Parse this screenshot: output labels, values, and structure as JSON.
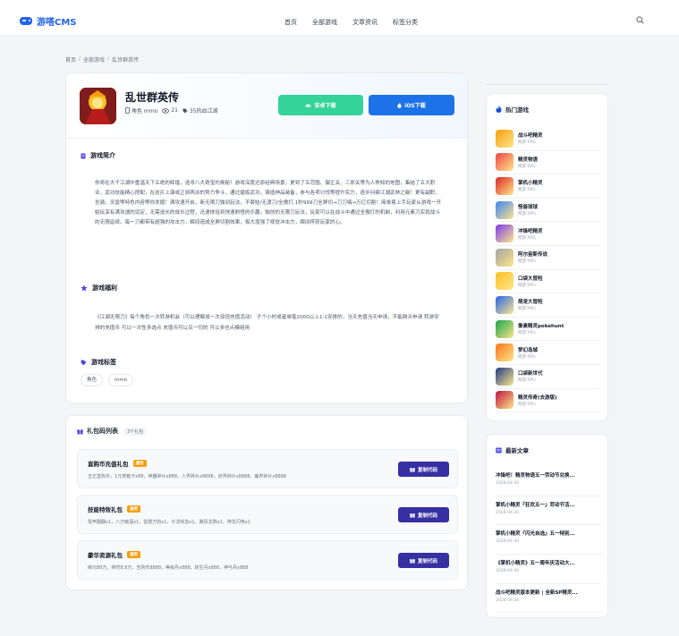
{
  "header": {
    "logo_text": "游嗒CMS",
    "nav": [
      "首页",
      "全部游戏",
      "文章资讯",
      "标签分类"
    ]
  },
  "breadcrumb": [
    "首页",
    "全部游戏",
    "乱世群英传"
  ],
  "game": {
    "title": "乱世群英传",
    "category": "角色 mmo",
    "views": "21",
    "tag_label": "35热血江湖",
    "android_label": "安卓下载",
    "ios_label": "iOS下载"
  },
  "intro": {
    "title": "游戏简介",
    "text": "你将在大千江湖中重温天下五绝的辉煌，追寻八大奇宝的奥秘！游戏深度还原经典场景，更到了五范围、御正关、三邪关等为人熟知的地图，集结了五大职业，武功技能精心搭配，在这片上演或正邪两派的势力争斗，通过磨练武功，铸造神品装备，参与各项讨伐等提升实力，逐步问鼎江湖武林之巅！更有副职、坐骑、灵兽等特色内容等你发掘！满攻速开启，新无限刀独到玩法，不套娃/无渡刀/全傲打,1秒999刀全屏切→刀刀嗨→万亿切割！简单易上手玩家从游戏一开始玩享有满攻速的设定，无需追长的成长过程，迅速体验到快速刷怪的乐趣。独创的无限刀玩法，玩家可以在战斗中通过全傲打的机制，利用元素刀实现战斗的无限延续。每一刀都带有超强的攻击力，瞬间造成全屏切割效果，极大增强了视觉冲击力，瞬间俘获玩家的心。"
  },
  "benefit": {
    "title": "游戏福利",
    "text": "《江湖无限刀》每个角色一次转游机会（可以理解成一次双倍充值活动） 子个小时或者单笔2000以上1:1安排的，当天充值当天申请，不能跨天申请 转游安排的充值币 可以一次性多选点 充值币可以买一切的 可以多也点模组用"
  },
  "tags": {
    "title": "游戏标签",
    "items": [
      "角色",
      "mmo"
    ]
  },
  "gifts": {
    "title": "礼包码列表",
    "count": "3个礼包",
    "copy_label": "复制代码",
    "items": [
      {
        "name": "直购币充值礼包",
        "badge": "通用",
        "desc": "五亿直购币，1元宠箱卡x88，神器碎片x888，人界碎片x8888，妖界碎片x8888，魔界碎片x8888"
      },
      {
        "name": "技能特效礼包",
        "badge": "通用",
        "desc": "零声翻翻x1，八方敏酒x1，雷霆万钧x1，炎龙咏急x1，飓风龙鸦x1，神龙闪电x1"
      },
      {
        "name": "豪华资源礼包",
        "badge": "通用",
        "desc": "绑元88万，绑符8.8万，吉购币8888，等级丹x888，转生丹x888，神弓丹x888"
      }
    ]
  },
  "hot_games": {
    "title": "热门游戏",
    "items": [
      {
        "name": "战斗吧精灵",
        "genre": "网游 RPG",
        "color": "#f59e0b"
      },
      {
        "name": "精灵物语",
        "genre": "网游 RPG",
        "color": "#ef4444"
      },
      {
        "name": "掌机小精灵",
        "genre": "网游 RPG",
        "color": "#dc2626"
      },
      {
        "name": "怪兽球球",
        "genre": "网游 RPG",
        "color": "#3b82f6"
      },
      {
        "name": "冲锋吧精灵",
        "genre": "网游 RPG",
        "color": "#7c3aed"
      },
      {
        "name": "阿尔宙斯传说",
        "genre": "网游 RPG",
        "color": "#a3a3a3"
      },
      {
        "name": "口袋大冒险",
        "genre": "网游 RPG",
        "color": "#fbbf24"
      },
      {
        "name": "萌宠大冒险",
        "genre": "网游 RPG",
        "color": "#2563eb"
      },
      {
        "name": "像素精灵pokehunt",
        "genre": "网游 RPG",
        "color": "#16a34a"
      },
      {
        "name": "梦幻岛城",
        "genre": "网游 RPG",
        "color": "#f97316"
      },
      {
        "name": "口袋新世代",
        "genre": "网游 RPG",
        "color": "#1e3a8a"
      },
      {
        "name": "精灵传奇(去游版)",
        "genre": "网游 RPG",
        "color": "#be123c"
      }
    ]
  },
  "news": {
    "title": "最新文章",
    "items": [
      {
        "title": "冲锋吧！精灵物语五一劳动节兑换...",
        "date": "2026-04-30"
      },
      {
        "title": "掌机小精灵『狂欢五一』劳动节活...",
        "date": "2026-04-30"
      },
      {
        "title": "掌机小精灵『闪光自选』五一特别...",
        "date": "2026-04-30"
      },
      {
        "title": "《掌机小精灵》五一周年庆活动大...",
        "date": "2026-04-30"
      },
      {
        "title": "战斗吧精灵版本更新 | 全新SP精灵...",
        "date": "2026-04-28"
      }
    ]
  }
}
